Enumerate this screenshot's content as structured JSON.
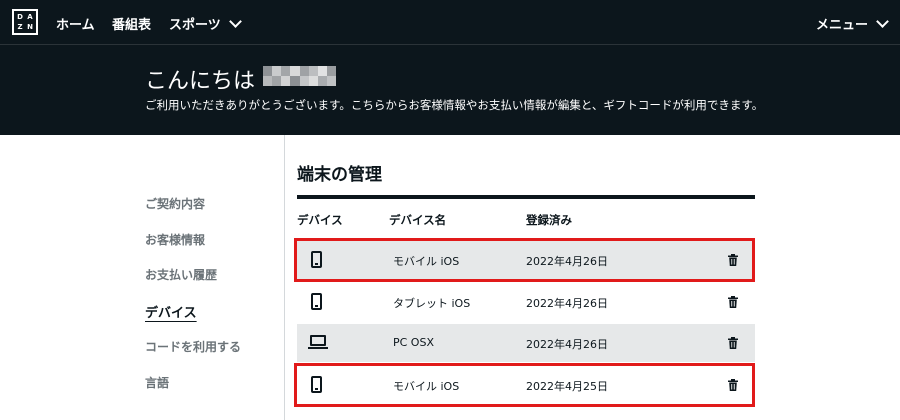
{
  "nav": {
    "logo_letters": [
      "D",
      "A",
      "Z",
      "N"
    ],
    "home": "ホーム",
    "schedule": "番組表",
    "sports": "スポーツ",
    "menu": "メニュー"
  },
  "hero": {
    "greeting": "こんにちは",
    "subtitle": "ご利用いただきありがとうございます。こちらからお客様情報やお支払い情報が編集と、ギフトコードが利用できます。"
  },
  "sidebar": {
    "items": [
      {
        "label": "ご契約内容",
        "active": false
      },
      {
        "label": "お客様情報",
        "active": false
      },
      {
        "label": "お支払い履歴",
        "active": false
      },
      {
        "label": "デバイス",
        "active": true
      },
      {
        "label": "コードを利用する",
        "active": false
      },
      {
        "label": "言語",
        "active": false
      }
    ]
  },
  "main": {
    "title": "端末の管理",
    "columns": {
      "device": "デバイス",
      "device_name": "デバイス名",
      "registered": "登録済み"
    },
    "rows": [
      {
        "icon": "smartphone-icon",
        "name": "モバイル iOS",
        "date": "2022年4月26日",
        "highlighted": true
      },
      {
        "icon": "smartphone-icon",
        "name": "タブレット iOS",
        "date": "2022年4月26日",
        "highlighted": false
      },
      {
        "icon": "laptop-icon",
        "name": "PC OSX",
        "date": "2022年4月26日",
        "highlighted": false
      },
      {
        "icon": "smartphone-icon",
        "name": "モバイル iOS",
        "date": "2022年4月25日",
        "highlighted": true
      }
    ]
  },
  "colors": {
    "background_dark": "#0c161c",
    "row_shade": "#e6e8e9",
    "highlight_red": "#e11a1a",
    "muted_text": "#6b7378"
  }
}
